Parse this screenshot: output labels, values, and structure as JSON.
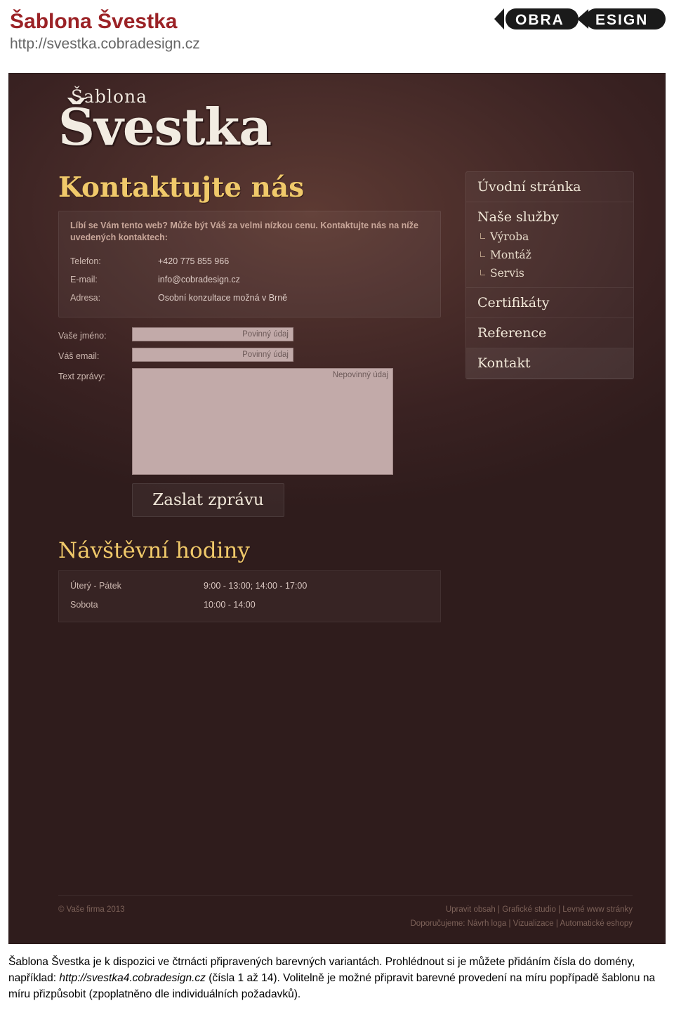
{
  "header": {
    "title": "Šablona Švestka",
    "url": "http://svestka.cobradesign.cz",
    "logo_text_left": "OBRA",
    "logo_text_right": "ESIGN"
  },
  "template": {
    "logo_small": "Šablona",
    "logo_big": "Švestka",
    "page_heading": "Kontaktujte nás",
    "info": {
      "lead": "Líbí se Vám tento web? Může být Váš za velmi nízkou cenu. Kontaktujte nás na níže uvedených kontaktech:",
      "rows": [
        {
          "label": "Telefon:",
          "value": "+420 775 855 966"
        },
        {
          "label": "E-mail:",
          "value": "info@cobradesign.cz"
        },
        {
          "label": "Adresa:",
          "value": "Osobní konzultace možná v Brně"
        }
      ]
    },
    "form": {
      "name_label": "Vaše jméno:",
      "name_placeholder": "Povinný údaj",
      "email_label": "Váš email:",
      "email_placeholder": "Povinný údaj",
      "message_label": "Text zprávy:",
      "message_placeholder": "Nepovinný údaj",
      "submit_label": "Zaslat zprávu"
    },
    "hours": {
      "heading": "Návštěvní hodiny",
      "rows": [
        {
          "day": "Úterý - Pátek",
          "value": "9:00 - 13:00; 14:00 - 17:00"
        },
        {
          "day": "Sobota",
          "value": "10:00 - 14:00"
        }
      ]
    },
    "menu": {
      "home": "Úvodní stránka",
      "services_head": "Naše služby",
      "services": [
        "Výroba",
        "Montáž",
        "Servis"
      ],
      "certificates": "Certifikáty",
      "references": "Reference",
      "contact": "Kontakt"
    },
    "footer": {
      "copyright": "© Vaše firma 2013",
      "links_line1": [
        "Upravit obsah",
        "Grafické studio",
        "Levné www stránky"
      ],
      "line2_prefix": "Doporučujeme:",
      "links_line2": [
        "Návrh loga",
        "Vizualizace",
        "Automatické eshopy"
      ]
    }
  },
  "note": {
    "part1": "Šablona Švestka je k dispozici ve čtrnácti připravených barevných variantách. Prohlédnout si je můžete přidáním čísla do domény, například: ",
    "link": "http://svestka4.cobradesign.cz",
    "part2": " (čísla 1 až 14). Volitelně je možné připravit barevné provedení na míru popřípadě šablonu na míru přizpůsobit (zpoplatněno dle individuálních požadavků)."
  }
}
